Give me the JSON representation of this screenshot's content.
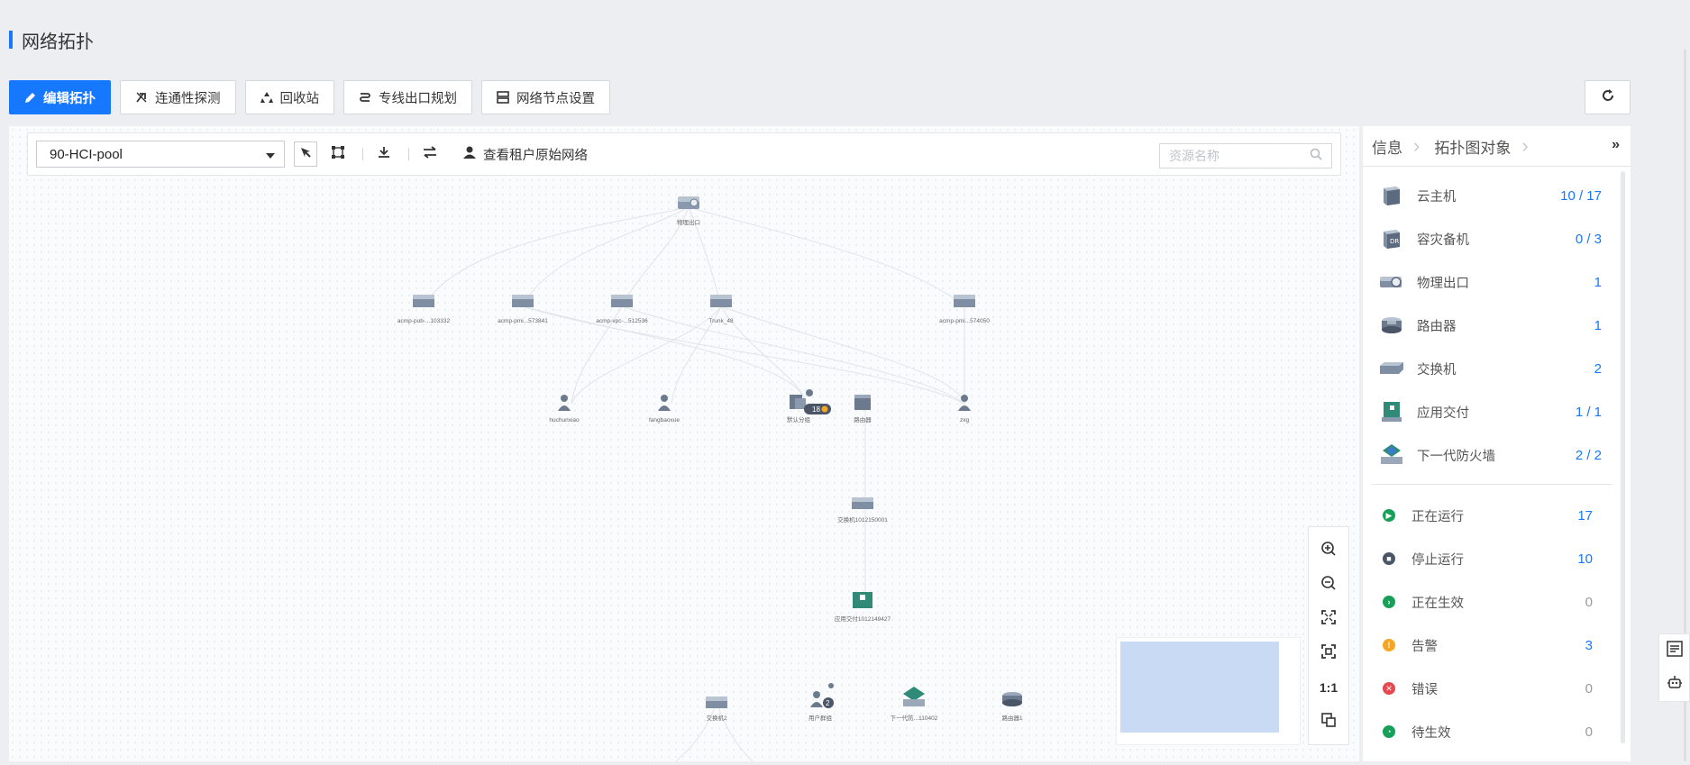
{
  "page": {
    "title": "网络拓扑"
  },
  "toolbar": {
    "edit_label": "编辑拓扑",
    "probe_label": "连通性探测",
    "recycle_label": "回收站",
    "line_label": "专线出口规划",
    "node_label": "网络节点设置"
  },
  "canvas": {
    "pool": "90-HCI-pool",
    "view_tenant_label": "查看租户原始网络",
    "search_placeholder": "资源名称",
    "zoom_ratio_label": "1:1"
  },
  "topology": {
    "nodes": {
      "root": "物理出口",
      "r1": "acmp-pub-...103332",
      "r2": "acmp-pmi...573841",
      "r3": "acmp-vpc-...512536",
      "r4": "Trunk_48",
      "r5": "acmp-pmi...574050",
      "u1": "huchunxiao",
      "u2": "fangbaoxue",
      "c1": "默认分组",
      "c1_badge": "18",
      "c2": "路由器",
      "c3": "zxg",
      "sw": "交换机1012150001",
      "ad": "应用交付1012149427",
      "b1": "交换机2",
      "b2": "用户群组",
      "b2_badge": "2",
      "b3": "下一代防...110402",
      "b4": "路由器1"
    }
  },
  "side_panel": {
    "tab_info": "信息",
    "tab_objects": "拓扑图对象",
    "objects": [
      {
        "label": "云主机",
        "count": "10 / 17",
        "icon": "vm-icon"
      },
      {
        "label": "容灾备机",
        "count": "0 / 3",
        "icon": "dr-vm-icon"
      },
      {
        "label": "物理出口",
        "count": "1",
        "icon": "physical-exit-icon"
      },
      {
        "label": "路由器",
        "count": "1",
        "icon": "router-icon"
      },
      {
        "label": "交换机",
        "count": "2",
        "icon": "switch-icon"
      },
      {
        "label": "应用交付",
        "count": "1 / 1",
        "icon": "app-delivery-icon"
      },
      {
        "label": "下一代防火墙",
        "count": "2 / 2",
        "icon": "firewall-icon"
      }
    ],
    "statuses": [
      {
        "label": "正在运行",
        "count": "17",
        "color": "#18a058"
      },
      {
        "label": "停止运行",
        "count": "10",
        "color": "#4a5568"
      },
      {
        "label": "正在生效",
        "count": "0",
        "color": "#18a058"
      },
      {
        "label": "告警",
        "count": "3",
        "color": "#f5a623"
      },
      {
        "label": "错误",
        "count": "0",
        "color": "#e5484d"
      },
      {
        "label": "待生效",
        "count": "0",
        "color": "#18a058"
      }
    ]
  }
}
